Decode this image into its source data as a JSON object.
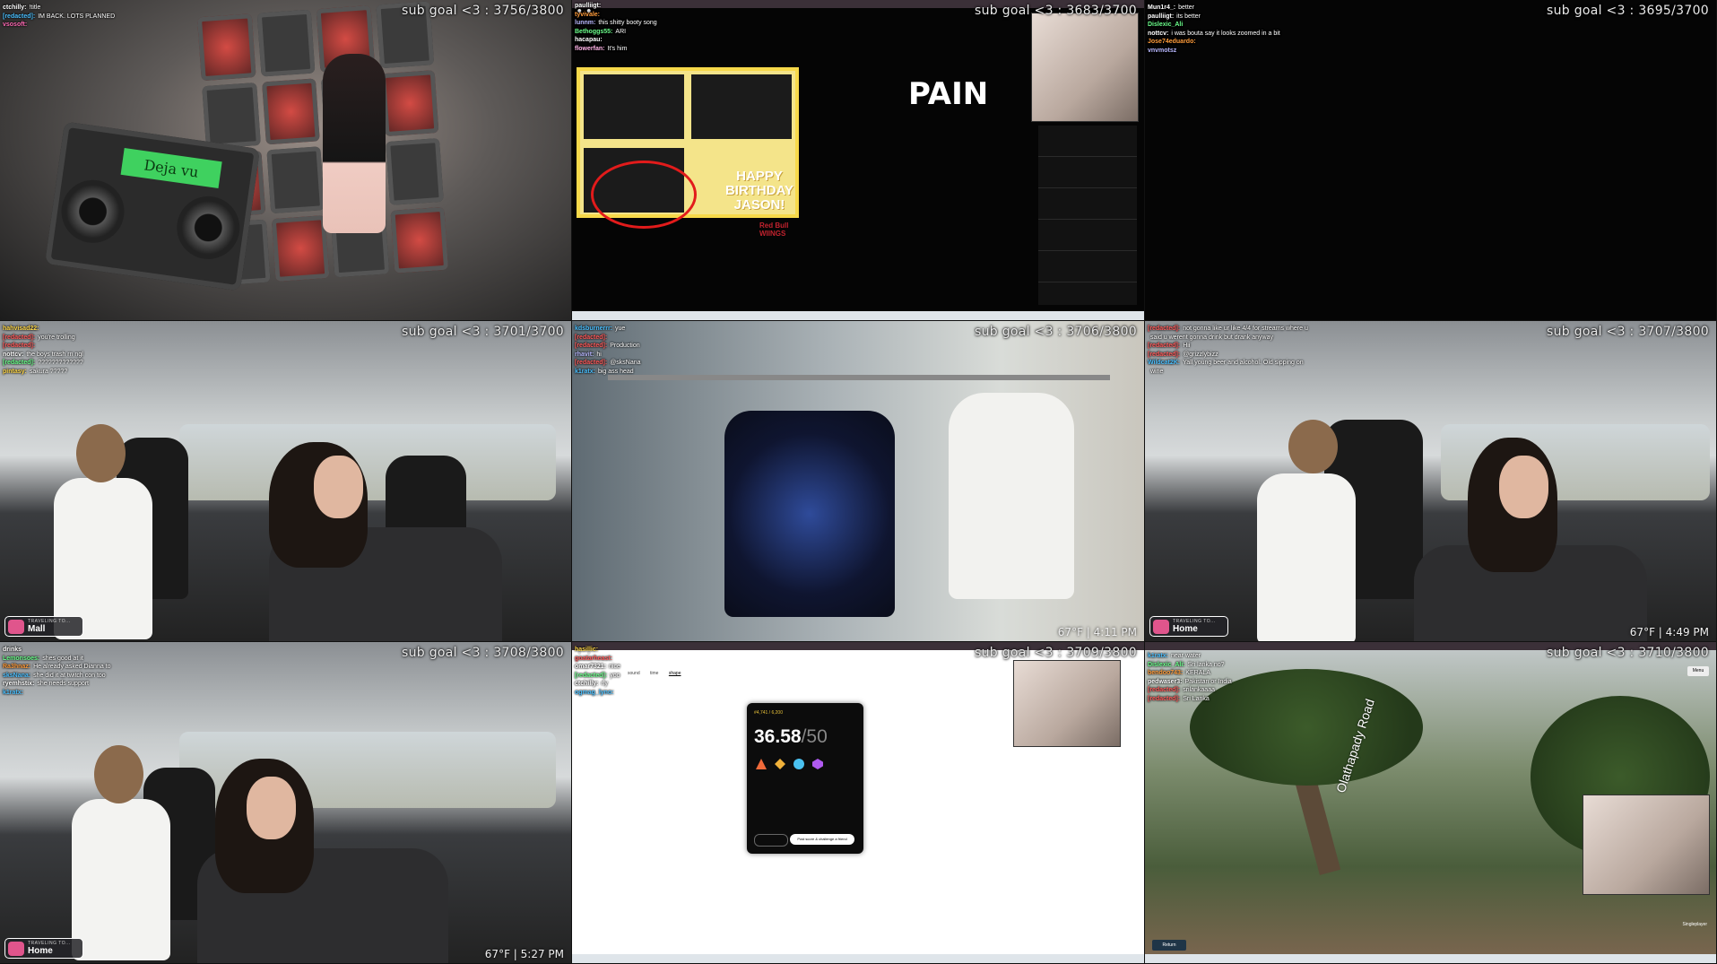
{
  "tiles": [
    {
      "goal": "sub goal <3 : 3756/3800",
      "chat": [
        {
          "user": "ctchilly:",
          "color": "#ffffff",
          "msg": "!title"
        },
        {
          "user": "[redacted]:",
          "color": "#4bc0ff",
          "msg": "IM BACK. LOTS PLANNED"
        },
        {
          "user": "vsosoft:",
          "color": "#ff6bb5",
          "msg": ""
        }
      ],
      "radio_text": "Deja vu"
    },
    {
      "goal": "sub goal <3 : 3683/3700",
      "chat": [
        {
          "user": "paulliigt:",
          "color": "#ffffff",
          "msg": ""
        },
        {
          "user": "tyvivale:",
          "color": "#ff9c3b",
          "msg": ""
        },
        {
          "user": "lunnm:",
          "color": "#b9b9ff",
          "msg": "this shitty booty song"
        },
        {
          "user": "Bethoggs55:",
          "color": "#6bff8b",
          "msg": "ARI"
        },
        {
          "user": "hacapau:",
          "color": "#ffffff",
          "msg": ""
        },
        {
          "user": "flowerfan:",
          "color": "#ffb3e6",
          "msg": "It's him"
        }
      ],
      "birthday_title": "HAPPY BIRTHDAY JASON!",
      "brand": "Red Bull",
      "brand2": "WIINGS",
      "overlay_word": "PAIN"
    },
    {
      "goal": "sub goal <3 : 3695/3700",
      "chat": [
        {
          "user": "Mun1r4_:",
          "color": "#ffffff",
          "msg": "better"
        },
        {
          "user": "paulliigt:",
          "color": "#ffffff",
          "msg": "its better"
        },
        {
          "user": "Dislexic_Ali",
          "color": "#6bff8b",
          "msg": ""
        },
        {
          "user": "nottcv:",
          "color": "#ffffff",
          "msg": "i was bouta say it looks zoomed in a bit"
        },
        {
          "user": "Jose74eduardo:",
          "color": "#ff9c3b",
          "msg": ""
        },
        {
          "user": "vnvmotsz",
          "color": "#b9b9ff",
          "msg": ""
        }
      ]
    },
    {
      "goal": "sub goal <3 : 3701/3700",
      "chat": [
        {
          "user": "hahvisad22:",
          "color": "#ffd84a",
          "msg": ""
        },
        {
          "user": "[redacted]:",
          "color": "#ff5b5b",
          "msg": "you're trolling"
        },
        {
          "user": "[redacted]:",
          "color": "#ff5b5b",
          "msg": ""
        },
        {
          "user": "nottcv:",
          "color": "#ffffff",
          "msg": "the boys trash rn ngl"
        },
        {
          "user": "[redacted]:",
          "color": "#6bff8b",
          "msg": "?????????????"
        },
        {
          "user": "pintasy:",
          "color": "#ffd84a",
          "msg": "sakura ?????"
        }
      ],
      "travel_small": "TRAVELING TO...",
      "travel_dest": "Mall"
    },
    {
      "goal": "sub goal <3 : 3706/3800",
      "chat": [
        {
          "user": "kdsburnerrr:",
          "color": "#4bc0ff",
          "msg": "yue"
        },
        {
          "user": "[redacted]:",
          "color": "#ff5b5b",
          "msg": ""
        },
        {
          "user": "[redacted]:",
          "color": "#ff5b5b",
          "msg": "Production"
        },
        {
          "user": "rhavit:",
          "color": "#b9b9ff",
          "msg": "hi"
        },
        {
          "user": "[redacted]:",
          "color": "#ff5b5b",
          "msg": "@sksNana"
        },
        {
          "user": "k1ratx:",
          "color": "#4bc0ff",
          "msg": "big ass head"
        }
      ],
      "weather": "67°F | 4:11 PM"
    },
    {
      "goal": "sub goal <3 : 3707/3800",
      "chat": [
        {
          "user": "[redacted]:",
          "color": "#ff5b5b",
          "msg": "not gonna like ur like 4/4 for streams where u"
        },
        {
          "user": "",
          "color": "#ffffff",
          "msg": "said u werent gonna drink but drank anyway"
        },
        {
          "user": "[redacted]:",
          "color": "#ff5b5b",
          "msg": "Hii"
        },
        {
          "user": "[redacted]:",
          "color": "#ff5b5b",
          "msg": "@grizzlybizz"
        },
        {
          "user": "Wildcat2K:",
          "color": "#4bc0ff",
          "msg": "Yall young beer and alcohol. Old sipping on"
        },
        {
          "user": "",
          "color": "#ffffff",
          "msg": "wine"
        }
      ],
      "travel_small": "TRAVELING TO...",
      "travel_dest": "Home",
      "weather": "67°F | 4:49 PM"
    },
    {
      "goal": "sub goal <3 : 3708/3800",
      "chat": [
        {
          "user": "drinks",
          "color": "#ffffff",
          "msg": ""
        },
        {
          "user": "Lemonsoes:",
          "color": "#6bff8b",
          "msg": "shes good at it"
        },
        {
          "user": "Ra3hnaz:",
          "color": "#ff9c3b",
          "msg": "He already asked Dianna to"
        },
        {
          "user": "sksNana:",
          "color": "#4bc0ff",
          "msg": "she did it at twitch con too"
        },
        {
          "user": "ryemhstix:",
          "color": "#ffffff",
          "msg": "she needs support"
        },
        {
          "user": "k1ratx:",
          "color": "#4bc0ff",
          "msg": ""
        }
      ],
      "travel_small": "TRAVELING TO...",
      "travel_dest": "Home",
      "weather": "67°F | 5:27 PM"
    },
    {
      "goal": "sub goal <3 : 3709/3800",
      "chat": [
        {
          "user": "hasillic:",
          "color": "#ffd84a",
          "msg": ""
        },
        {
          "user": "goatarheast:",
          "color": "#ff5b5b",
          "msg": ""
        },
        {
          "user": "omar7321:",
          "color": "#ffffff",
          "msg": "nice"
        },
        {
          "user": "[redacted]:",
          "color": "#6bff8b",
          "msg": "yoo"
        },
        {
          "user": "ctchilly:",
          "color": "#ffffff",
          "msg": "rly"
        },
        {
          "user": "ogmag_lyno:",
          "color": "#4bc0ff",
          "msg": ""
        }
      ],
      "nav": [
        "sound",
        "time",
        "shape"
      ],
      "card_small": "#4,741 / 6,200",
      "score_num": "36.58",
      "score_den": "/50",
      "post_btn": "Post score & challenge a friend"
    },
    {
      "goal": "sub goal <3 : 3710/3800",
      "chat": [
        {
          "user": "k1ratx:",
          "color": "#4bc0ff",
          "msg": "near water"
        },
        {
          "user": "Dislexic_Ali:",
          "color": "#6bff8b",
          "msg": "Sri lanka no?"
        },
        {
          "user": "bendoo743:",
          "color": "#ff9c3b",
          "msg": "KERALA"
        },
        {
          "user": "pedwaser3:",
          "color": "#ffffff",
          "msg": "Pakistan or India"
        },
        {
          "user": "[redacted]:",
          "color": "#ff5b5b",
          "msg": "srilankaaaa"
        },
        {
          "user": "[redacted]:",
          "color": "#ff5b5b",
          "msg": "Sri Lanka"
        }
      ],
      "menu_btn": "Menu",
      "return_btn": "Return",
      "street_label": "Olathapady Road",
      "mode_label": "Singleplayer"
    }
  ]
}
